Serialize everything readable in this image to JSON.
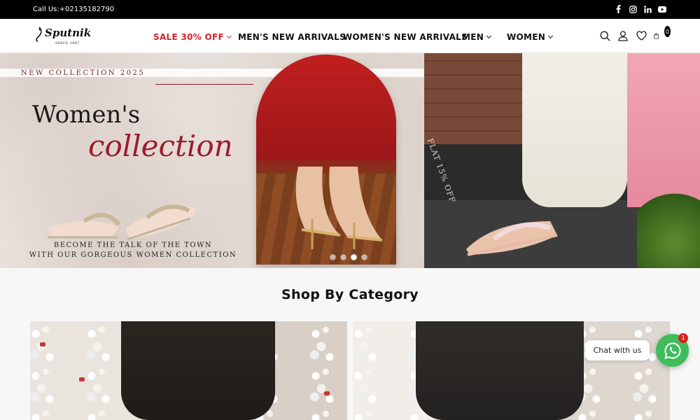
{
  "topbar": {
    "call": "Call Us:+02135182790",
    "socials": [
      "facebook-icon",
      "instagram-icon",
      "linkedin-icon",
      "youtube-icon"
    ]
  },
  "header": {
    "logo_name": "Sputnik",
    "logo_since": "SINCE 1967",
    "nav": [
      {
        "label": "SALE 30% OFF",
        "dropdown": true,
        "highlight": "#d0252b"
      },
      {
        "label": "MEN'S NEW ARRIVALS",
        "dropdown": false
      },
      {
        "label": "WOMEN'S NEW ARRIVALS",
        "dropdown": false
      },
      {
        "label": "MEN",
        "dropdown": true
      },
      {
        "label": "WOMEN",
        "dropdown": true
      }
    ],
    "cart_count": "0"
  },
  "hero": {
    "kicker": "NEW COLLECTION 2025",
    "title_line1": "Women's",
    "title_line2": "collection",
    "tagline_line1": "BECOME THE TALK OF THE TOWN",
    "tagline_line2": "WITH OUR GORGEOUS WOMEN COLLECTION",
    "promo": "FLAT 15% OFF",
    "slides": 4,
    "active_slide": 3
  },
  "categories": {
    "title": "Shop By Category"
  },
  "chat": {
    "label": "Chat with us",
    "badge": "1"
  }
}
